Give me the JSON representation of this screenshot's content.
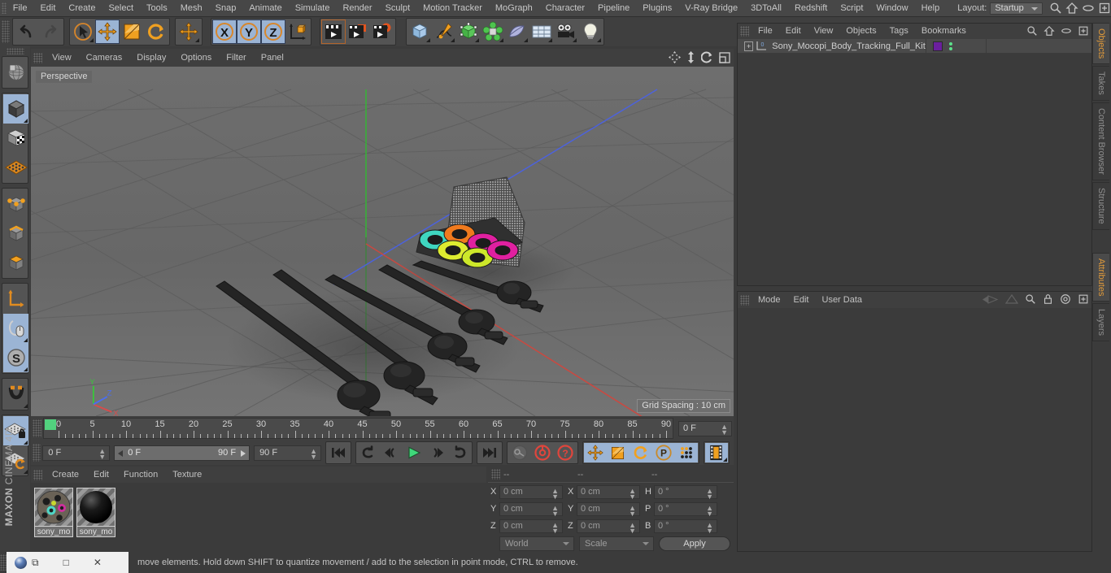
{
  "menubar": {
    "items": [
      "File",
      "Edit",
      "Create",
      "Select",
      "Tools",
      "Mesh",
      "Snap",
      "Animate",
      "Simulate",
      "Render",
      "Sculpt",
      "Motion Tracker",
      "MoGraph",
      "Character",
      "Pipeline",
      "Plugins",
      "V-Ray Bridge",
      "3DToAll",
      "Redshift",
      "Script",
      "Window",
      "Help"
    ],
    "layout_label": "Layout:",
    "layout_value": "Startup"
  },
  "toolbar": {
    "groups": [
      {
        "name": "history",
        "buttons": [
          {
            "name": "undo-button",
            "icon": "undo",
            "selected": false
          },
          {
            "name": "redo-button",
            "icon": "redo",
            "selected": false
          }
        ]
      },
      {
        "name": "transform",
        "buttons": [
          {
            "name": "live-selection-tool",
            "icon": "cursor-circle",
            "selected": false,
            "corner": true
          },
          {
            "name": "move-tool",
            "icon": "move-arrows",
            "selected": true
          },
          {
            "name": "scale-tool",
            "icon": "scale-box",
            "selected": false
          },
          {
            "name": "rotate-tool",
            "icon": "rotate-arc",
            "selected": false
          }
        ]
      },
      {
        "name": "move-single",
        "buttons": [
          {
            "name": "move-tool-2",
            "icon": "move-arrows",
            "selected": false,
            "corner": true
          }
        ]
      },
      {
        "name": "axis-lock",
        "buttons": [
          {
            "name": "x-axis-lock-button",
            "icon": "x-axis",
            "selected": true
          },
          {
            "name": "y-axis-lock-button",
            "icon": "y-axis",
            "selected": true
          },
          {
            "name": "z-axis-lock-button",
            "icon": "z-axis",
            "selected": true
          },
          {
            "name": "world-object-coordinate-button",
            "icon": "world-axis",
            "selected": false
          }
        ]
      },
      {
        "name": "render",
        "buttons": [
          {
            "name": "render-view-button",
            "icon": "clapper-plain",
            "selected": false,
            "active": true
          },
          {
            "name": "render-to-picture-viewer-button",
            "icon": "clapper-red",
            "selected": false
          },
          {
            "name": "render-settings-button",
            "icon": "clapper-gear",
            "selected": false
          }
        ]
      },
      {
        "name": "create",
        "buttons": [
          {
            "name": "add-cube-button",
            "icon": "cube-blue",
            "selected": false,
            "corner": true
          },
          {
            "name": "add-spline-button",
            "icon": "pen-spline",
            "selected": false,
            "corner": true
          },
          {
            "name": "add-generator-button",
            "icon": "cube-green",
            "selected": false,
            "corner": true
          },
          {
            "name": "add-deformer-button",
            "icon": "atom-green",
            "selected": false,
            "corner": true
          },
          {
            "name": "add-scene-object-button",
            "icon": "bend-shape",
            "selected": false,
            "corner": true
          },
          {
            "name": "add-environment-button",
            "icon": "floor-grid",
            "selected": false,
            "corner": true
          },
          {
            "name": "add-camera-button",
            "icon": "camera",
            "selected": false,
            "corner": true
          },
          {
            "name": "add-light-button",
            "icon": "light-bulb",
            "selected": false,
            "corner": true
          }
        ]
      }
    ]
  },
  "left_toolbar": {
    "groups": [
      {
        "buttons": [
          {
            "name": "make-editable-button",
            "icon": "globe-wire",
            "selected": false
          }
        ]
      },
      {
        "buttons": [
          {
            "name": "model-mode-button",
            "icon": "cube-dark",
            "selected": true,
            "corner": true
          },
          {
            "name": "texture-mode-button",
            "icon": "cube-checker",
            "selected": false
          },
          {
            "name": "workplane-mode-button",
            "icon": "plane-grid-orange",
            "selected": false
          }
        ]
      },
      {
        "buttons": [
          {
            "name": "points-mode-button",
            "icon": "cube-points",
            "selected": false
          },
          {
            "name": "edges-mode-button",
            "icon": "cube-edges",
            "selected": false
          },
          {
            "name": "polygons-mode-button",
            "icon": "cube-polys",
            "selected": false
          }
        ]
      },
      {
        "buttons": [
          {
            "name": "axis-modification-button",
            "icon": "axis-L",
            "selected": false
          },
          {
            "name": "enable-snapping-button",
            "icon": "magnet-mouse",
            "selected": true,
            "corner": true
          },
          {
            "name": "soft-selection-button",
            "icon": "s-circle",
            "selected": true,
            "corner": true
          }
        ]
      },
      {
        "buttons": [
          {
            "name": "magnet-tool-button",
            "icon": "magnet",
            "selected": false,
            "corner": true
          }
        ]
      },
      {
        "buttons": [
          {
            "name": "lock-workplane-button",
            "icon": "plane-lock",
            "selected": true,
            "corner": true
          },
          {
            "name": "planar-workplane-button",
            "icon": "plane-rotate",
            "selected": false,
            "corner": true
          }
        ]
      }
    ],
    "brand_bold": "MAXON",
    "brand_thin": "CINEMA 4D"
  },
  "viewport": {
    "menu_items": [
      "View",
      "Cameras",
      "Display",
      "Options",
      "Filter",
      "Panel"
    ],
    "corner_icons": [
      "pan-icon",
      "dolly-icon",
      "rotate-icon",
      "maximize-icon"
    ],
    "perspective_label": "Perspective",
    "grid_spacing_label": "Grid Spacing : 10 cm",
    "axis_gizmo": {
      "x": "X",
      "y": "Y",
      "z": "Z",
      "x_color": "#d94b4b",
      "y_color": "#3ac53a",
      "z_color": "#4a6ef0"
    }
  },
  "timeline": {
    "ticks": [
      "0",
      "5",
      "10",
      "15",
      "20",
      "25",
      "30",
      "35",
      "40",
      "45",
      "50",
      "55",
      "60",
      "65",
      "70",
      "75",
      "80",
      "85",
      "90"
    ],
    "current_frame_field": "0 F"
  },
  "playback": {
    "current_frame": "0 F",
    "range_start": "0 F",
    "range_end": "90 F",
    "max_frame": "90 F",
    "buttons": [
      {
        "name": "go-to-start-button",
        "icon": "skip-start"
      },
      {
        "name": "previous-keyframe-button",
        "icon": "prev-key"
      },
      {
        "name": "step-back-button",
        "icon": "step-back"
      },
      {
        "name": "play-button",
        "icon": "play"
      },
      {
        "name": "step-forward-button",
        "icon": "step-forward"
      },
      {
        "name": "next-keyframe-button",
        "icon": "next-key"
      },
      {
        "name": "go-to-end-button",
        "icon": "skip-end"
      }
    ],
    "record_buttons": [
      {
        "name": "record-active-objects-button",
        "icon": "key-grey"
      },
      {
        "name": "autokeying-button",
        "icon": "circle-red"
      },
      {
        "name": "keyframe-selection-button",
        "icon": "question-red"
      }
    ],
    "key_toggles": [
      {
        "name": "position-key-button",
        "icon": "move-arrows",
        "selected": true
      },
      {
        "name": "scale-key-button",
        "icon": "scale-box",
        "selected": true
      },
      {
        "name": "rotation-key-button",
        "icon": "rotate-arc",
        "selected": true
      },
      {
        "name": "parameter-key-button",
        "icon": "p-circle",
        "selected": true
      },
      {
        "name": "point-level-animation-button",
        "icon": "dots-grid",
        "selected": true
      }
    ],
    "timeline_toggle": {
      "name": "animation-mode-button",
      "icon": "film-strip",
      "selected": true
    }
  },
  "materials": {
    "menu_items": [
      "Create",
      "Edit",
      "Function",
      "Texture"
    ],
    "items": [
      {
        "name": "sony_mo",
        "selected": true,
        "type": "colorful"
      },
      {
        "name": "sony_mo",
        "selected": true,
        "type": "black"
      }
    ]
  },
  "coordinates": {
    "headers": [
      "--",
      "--",
      "--"
    ],
    "rows": [
      {
        "pos_label": "X",
        "pos_value": "0 cm",
        "size_label": "X",
        "size_value": "0 cm",
        "rot_label": "H",
        "rot_value": "0 °"
      },
      {
        "pos_label": "Y",
        "pos_value": "0 cm",
        "size_label": "Y",
        "size_value": "0 cm",
        "rot_label": "P",
        "rot_value": "0 °"
      },
      {
        "pos_label": "Z",
        "pos_value": "0 cm",
        "size_label": "Z",
        "size_value": "0 cm",
        "rot_label": "B",
        "rot_value": "0 °"
      }
    ],
    "space_dropdown": "World",
    "mode_dropdown": "Scale",
    "apply_button": "Apply"
  },
  "object_manager": {
    "menu_items": [
      "File",
      "Edit",
      "View",
      "Objects",
      "Tags",
      "Bookmarks"
    ],
    "icons": [
      "search-icon",
      "home-icon",
      "ellipse-icon",
      "add-panel-icon"
    ],
    "rows": [
      {
        "name": "Sony_Mocopi_Body_Tracking_Full_Kit",
        "layer_color": "#6b1f9e",
        "expandable": true,
        "level_badge": "0"
      }
    ]
  },
  "attributes": {
    "menu_items": [
      "Mode",
      "Edit",
      "User Data"
    ],
    "icons": [
      "prev-arrow-icon",
      "next-arrow-icon",
      "search-icon",
      "lock-icon",
      "target-icon",
      "add-panel-icon"
    ]
  },
  "right_tabs": {
    "top_group": [
      {
        "label": "Objects",
        "active": true
      },
      {
        "label": "Takes",
        "active": false
      },
      {
        "label": "Content Browser",
        "active": false
      },
      {
        "label": "Structure",
        "active": false
      }
    ],
    "bottom_group": [
      {
        "label": "Attributes",
        "active": true
      },
      {
        "label": "Layers",
        "active": false
      }
    ]
  },
  "statusbar": {
    "message": "move elements. Hold down SHIFT to quantize movement / add to the selection in point mode, CTRL to remove."
  },
  "taskbar": {
    "app_icon": "cinema4d-ball-icon",
    "buttons": [
      "minimize-icon",
      "maximize-icon",
      "close-icon"
    ]
  },
  "colors": {
    "accent_orange": "#e09a3a",
    "selection_blue": "#9bb4d4",
    "panel_bg": "#3b3b3b",
    "toolbar_bg": "#3f3f3f"
  }
}
